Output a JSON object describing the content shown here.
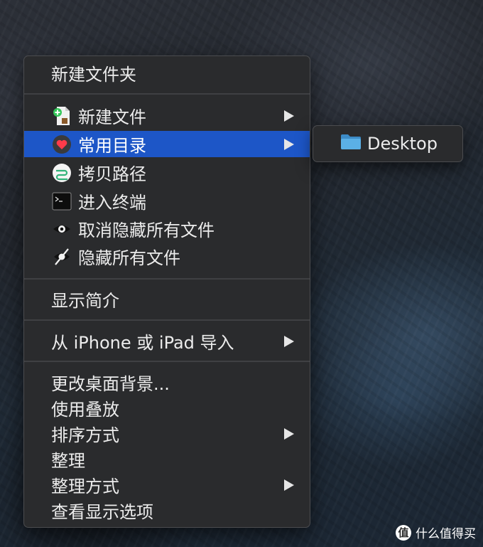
{
  "menu": {
    "new_folder": "新建文件夹",
    "new_file": "新建文件",
    "common_dirs": "常用目录",
    "copy_path": "拷贝路径",
    "open_terminal": "进入终端",
    "unhide_all": "取消隐藏所有文件",
    "hide_all": "隐藏所有文件",
    "get_info": "显示简介",
    "import_iphone": "从 iPhone 或 iPad 导入",
    "change_bg": "更改桌面背景...",
    "use_stacks": "使用叠放",
    "sort_by": "排序方式",
    "clean_up": "整理",
    "clean_up_by": "整理方式",
    "view_options": "查看显示选项"
  },
  "submenu": {
    "desktop": "Desktop"
  },
  "watermark": {
    "badge": "值",
    "text": "什么值得买"
  },
  "colors": {
    "selection": "#1d56c7",
    "menu_bg": "#2a2b2d",
    "folder": "#4a9fd8"
  }
}
